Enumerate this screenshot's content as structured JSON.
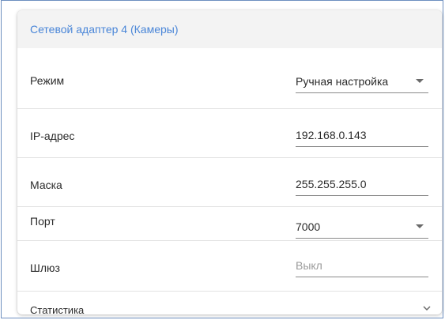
{
  "card": {
    "title": "Сетевой адаптер 4 (Камеры)"
  },
  "rows": {
    "mode": {
      "label": "Режим",
      "value": "Ручная настройка",
      "icon": "caret-down-icon"
    },
    "ip": {
      "label": "IP-адрес",
      "value": "192.168.0.143"
    },
    "mask": {
      "label": "Маска",
      "value": "255.255.255.0"
    },
    "port": {
      "label": "Порт",
      "value": "7000",
      "icon": "caret-down-icon"
    },
    "gateway": {
      "label": "Шлюз",
      "placeholder": "Выкл"
    },
    "stats": {
      "label": "Статистика",
      "icon": "chevron-down-icon"
    }
  },
  "colors": {
    "accent": "#4a86d8",
    "header_bg": "#f3f3f3",
    "frame_border": "#6d8fbf"
  }
}
